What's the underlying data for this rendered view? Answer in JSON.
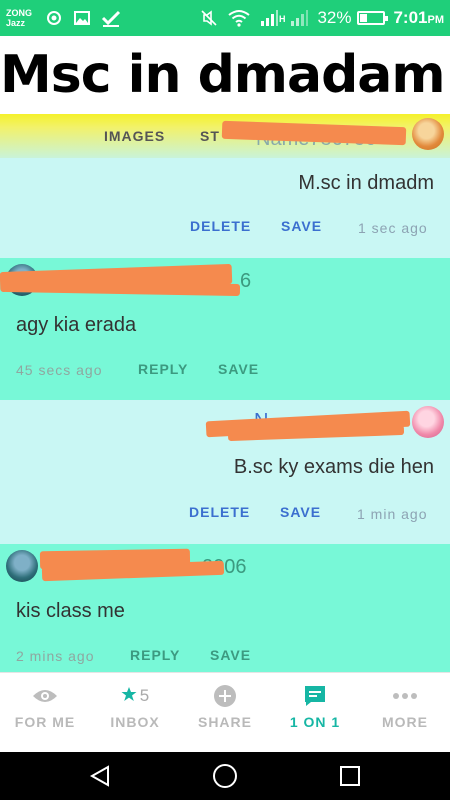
{
  "status_bar": {
    "carrier_line1": "ZONG",
    "carrier_line2": "Jazz",
    "network_h": "H",
    "battery": "32%",
    "time": "7:01",
    "ampm": "PM",
    "icons": [
      "location-target-icon",
      "image-icon",
      "check-icon",
      "mute-icon",
      "wifi-icon",
      "signal-icon",
      "signal-icon",
      "battery-icon"
    ]
  },
  "overlay_title": "Msc in dmadam",
  "top_tabs": {
    "images_label": "IMAGES",
    "stream_label_partial": "ST",
    "faded_name": "Name786786"
  },
  "messages": [
    {
      "kind": "sent",
      "text": "M.sc in dmadm",
      "delete_label": "DELETE",
      "save_label": "SAVE",
      "time": "1 sec ago"
    },
    {
      "kind": "received",
      "name_suffix": "6",
      "text": "agy kia erada",
      "time": "45 secs ago",
      "reply_label": "REPLY",
      "save_label": "SAVE"
    },
    {
      "kind": "sent",
      "name_prefix": "N",
      "text": "B.sc ky exams die hen",
      "delete_label": "DELETE",
      "save_label": "SAVE",
      "time": "1 min ago"
    },
    {
      "kind": "received",
      "name_suffix": "2006",
      "text": "kis class me",
      "time": "2 mins ago",
      "reply_label": "REPLY",
      "save_label": "SAVE"
    }
  ],
  "bottom_nav": {
    "items": [
      {
        "label": "FOR ME",
        "icon": "eye-icon"
      },
      {
        "label": "INBOX",
        "icon": "star-icon",
        "count": "5"
      },
      {
        "label": "SHARE",
        "icon": "plus-circle-icon"
      },
      {
        "label": "1 ON 1",
        "icon": "chat-icon",
        "active": true
      },
      {
        "label": "MORE",
        "icon": "more-dots-icon"
      }
    ]
  },
  "colors": {
    "status_green": "#1fcf7a",
    "sent_bg": "#c9f7f4",
    "received_bg": "#78f8d7",
    "accent_teal": "#16b6a4",
    "action_blue": "#3b6fcf",
    "redaction_orange": "#f58a4e"
  }
}
